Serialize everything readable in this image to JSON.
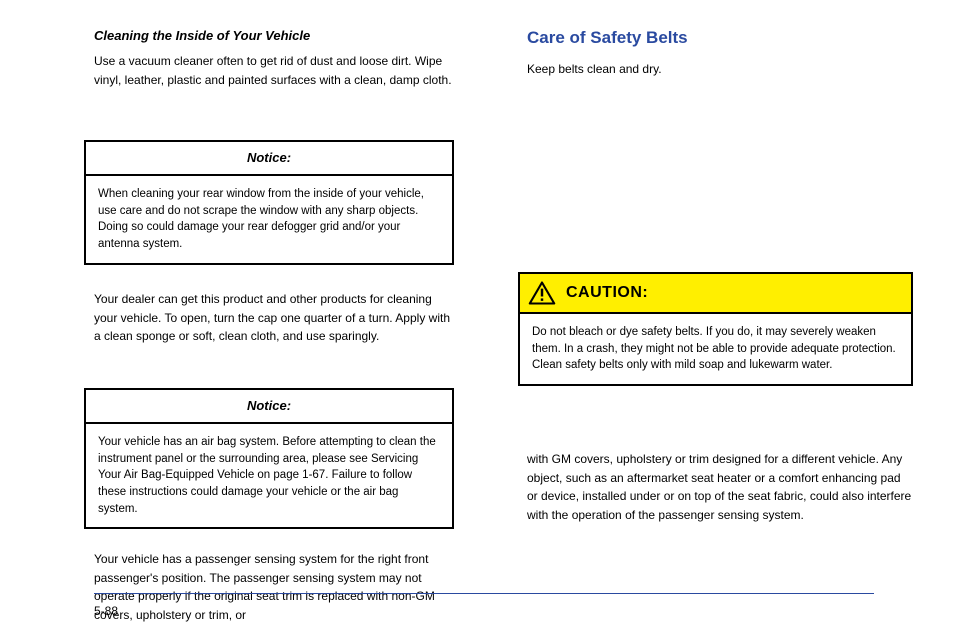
{
  "cleaning": {
    "heading": "Cleaning the Inside of Your Vehicle",
    "body": "Use a vacuum cleaner often to get rid of dust and loose dirt. Wipe vinyl, leather, plastic and painted surfaces with a clean, damp cloth."
  },
  "notices": [
    {
      "label": "Notice:",
      "body": "When cleaning your rear window from the inside of your vehicle, use care and do not scrape the window with any sharp objects. Doing so could damage your rear defogger grid and/or your antenna system."
    },
    {
      "label": "Notice:",
      "body": "Your vehicle has an air bag system. Before attempting to clean the instrument panel or the surrounding area, please see Servicing Your Air Bag-Equipped Vehicle on page 1-67. Failure to follow these instructions could damage your vehicle or the air bag system."
    }
  ],
  "intertext": [
    "Your dealer can get this product and other products for cleaning your vehicle. To open, turn the cap one quarter of a turn. Apply with a clean sponge or soft, clean cloth, and use sparingly.",
    "Your vehicle has a passenger sensing system for the right front passenger's position. The passenger sensing system may not operate properly if the original seat trim is replaced with non-GM covers, upholstery or trim, or"
  ],
  "right": {
    "heading": "Care of Safety Belts",
    "intro": "Keep belts clean and dry."
  },
  "caution": {
    "label": "CAUTION:",
    "body": "Do not bleach or dye safety belts. If you do, it may severely weaken them. In a crash, they might not be able to provide adequate protection. Clean safety belts only with mild soap and lukewarm water."
  },
  "caution_after": "with GM covers, upholstery or trim designed for a different vehicle. Any object, such as an aftermarket seat heater or a comfort enhancing pad or device, installed under or on top of the seat fabric, could also interfere with the operation of the passenger sensing system.",
  "page_number": "5-88"
}
